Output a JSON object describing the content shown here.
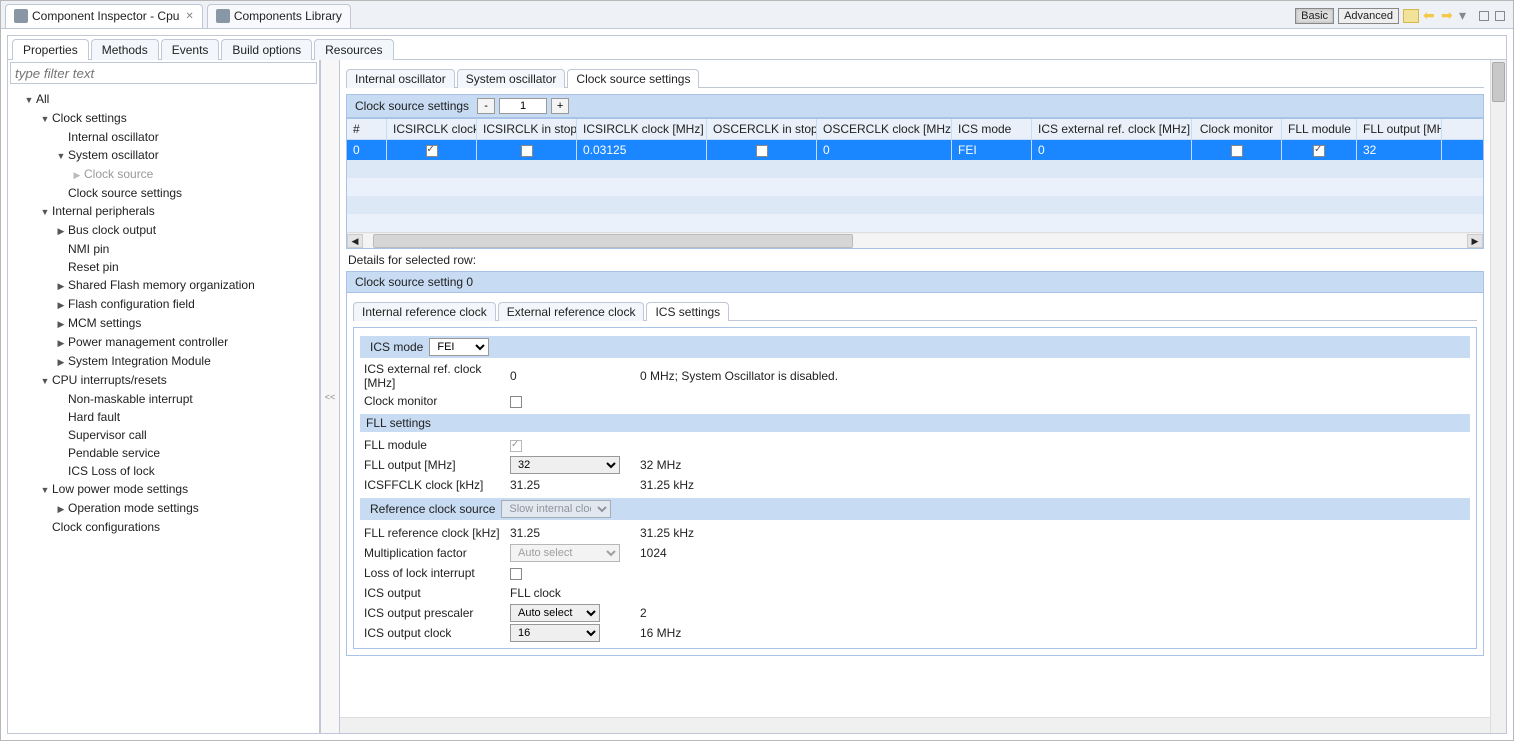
{
  "topTabs": [
    {
      "label": "Component Inspector - Cpu",
      "active": true,
      "closable": true
    },
    {
      "label": "Components Library",
      "active": false,
      "closable": false
    }
  ],
  "modeButtons": {
    "basic": "Basic",
    "advanced": "Advanced"
  },
  "subTabs": [
    "Properties",
    "Methods",
    "Events",
    "Build options",
    "Resources"
  ],
  "subTabActive": 0,
  "filterPlaceholder": "type filter text",
  "tree": {
    "root": "All",
    "clock_settings": "Clock settings",
    "internal_oscillator": "Internal oscillator",
    "system_oscillator": "System oscillator",
    "clock_source": "Clock source",
    "clock_source_settings": "Clock source settings",
    "internal_peripherals": "Internal peripherals",
    "bus_clock_output": "Bus clock output",
    "nmi_pin": "NMI pin",
    "reset_pin": "Reset pin",
    "shared_flash": "Shared Flash memory organization",
    "flash_config": "Flash configuration field",
    "mcm_settings": "MCM settings",
    "power_mgmt": "Power management controller",
    "sys_integration": "System Integration Module",
    "cpu_interrupts": "CPU interrupts/resets",
    "nmi": "Non-maskable interrupt",
    "hard_fault": "Hard fault",
    "supervisor_call": "Supervisor call",
    "pendable_service": "Pendable service",
    "ics_loss_lock": "ICS Loss of lock",
    "low_power": "Low power mode settings",
    "op_mode": "Operation mode settings",
    "clock_configs": "Clock configurations"
  },
  "splitter": "<<",
  "innerTabs": [
    "Internal oscillator",
    "System oscillator",
    "Clock source settings"
  ],
  "innerTabActive": 2,
  "gridTitle": "Clock source settings",
  "gridSpin": "1",
  "gridHeaders": [
    "#",
    "ICSIRCLK clock",
    "ICSIRCLK in stop",
    "ICSIRCLK clock [MHz]",
    "OSCERCLK in stop",
    "OSCERCLK clock [MHz]",
    "ICS mode",
    "ICS external ref. clock [MHz]",
    "Clock monitor",
    "FLL module",
    "FLL output [MHz]"
  ],
  "gridRow": {
    "idx": "0",
    "icsirclk_clock": true,
    "icsirclk_stop": false,
    "icsirclk_mhz": "0.03125",
    "oscerclk_stop": false,
    "oscerclk_mhz": "0",
    "ics_mode": "FEI",
    "ics_ext_ref": "0",
    "clock_monitor": false,
    "fll_module": true,
    "fll_output": "32"
  },
  "detailsLabel": "Details for selected row:",
  "detailTitle": "Clock source setting 0",
  "detailTabs": [
    "Internal reference clock",
    "External reference clock",
    "ICS settings"
  ],
  "detailTabActive": 2,
  "form": {
    "ics_mode_label": "ICS mode",
    "ics_mode_value": "FEI",
    "ics_ext_ref_label": "ICS external ref. clock [MHz]",
    "ics_ext_ref_value": "0",
    "ics_ext_ref_info": "0 MHz; System Oscillator is disabled.",
    "clock_monitor_label": "Clock monitor",
    "clock_monitor_checked": false,
    "fll_settings_head": "FLL settings",
    "fll_module_label": "FLL module",
    "fll_module_checked": true,
    "fll_output_label": "FLL output [MHz]",
    "fll_output_value": "32",
    "fll_output_info": "32 MHz",
    "icsffclk_label": "ICSFFCLK clock [kHz]",
    "icsffclk_value": "31.25",
    "icsffclk_info": "31.25 kHz",
    "ref_clock_src_label": "Reference clock source",
    "ref_clock_src_value": "Slow internal clock",
    "fll_ref_clock_label": "FLL reference clock [kHz]",
    "fll_ref_clock_value": "31.25",
    "fll_ref_clock_info": "31.25 kHz",
    "mult_factor_label": "Multiplication factor",
    "mult_factor_value": "Auto select",
    "mult_factor_info": "1024",
    "loss_lock_label": "Loss of lock interrupt",
    "loss_lock_checked": false,
    "ics_output_label": "ICS output",
    "ics_output_value": "FLL clock",
    "ics_prescaler_label": "ICS output prescaler",
    "ics_prescaler_value": "Auto select",
    "ics_prescaler_info": "2",
    "ics_out_clock_label": "ICS output clock",
    "ics_out_clock_value": "16",
    "ics_out_clock_info": "16 MHz"
  }
}
